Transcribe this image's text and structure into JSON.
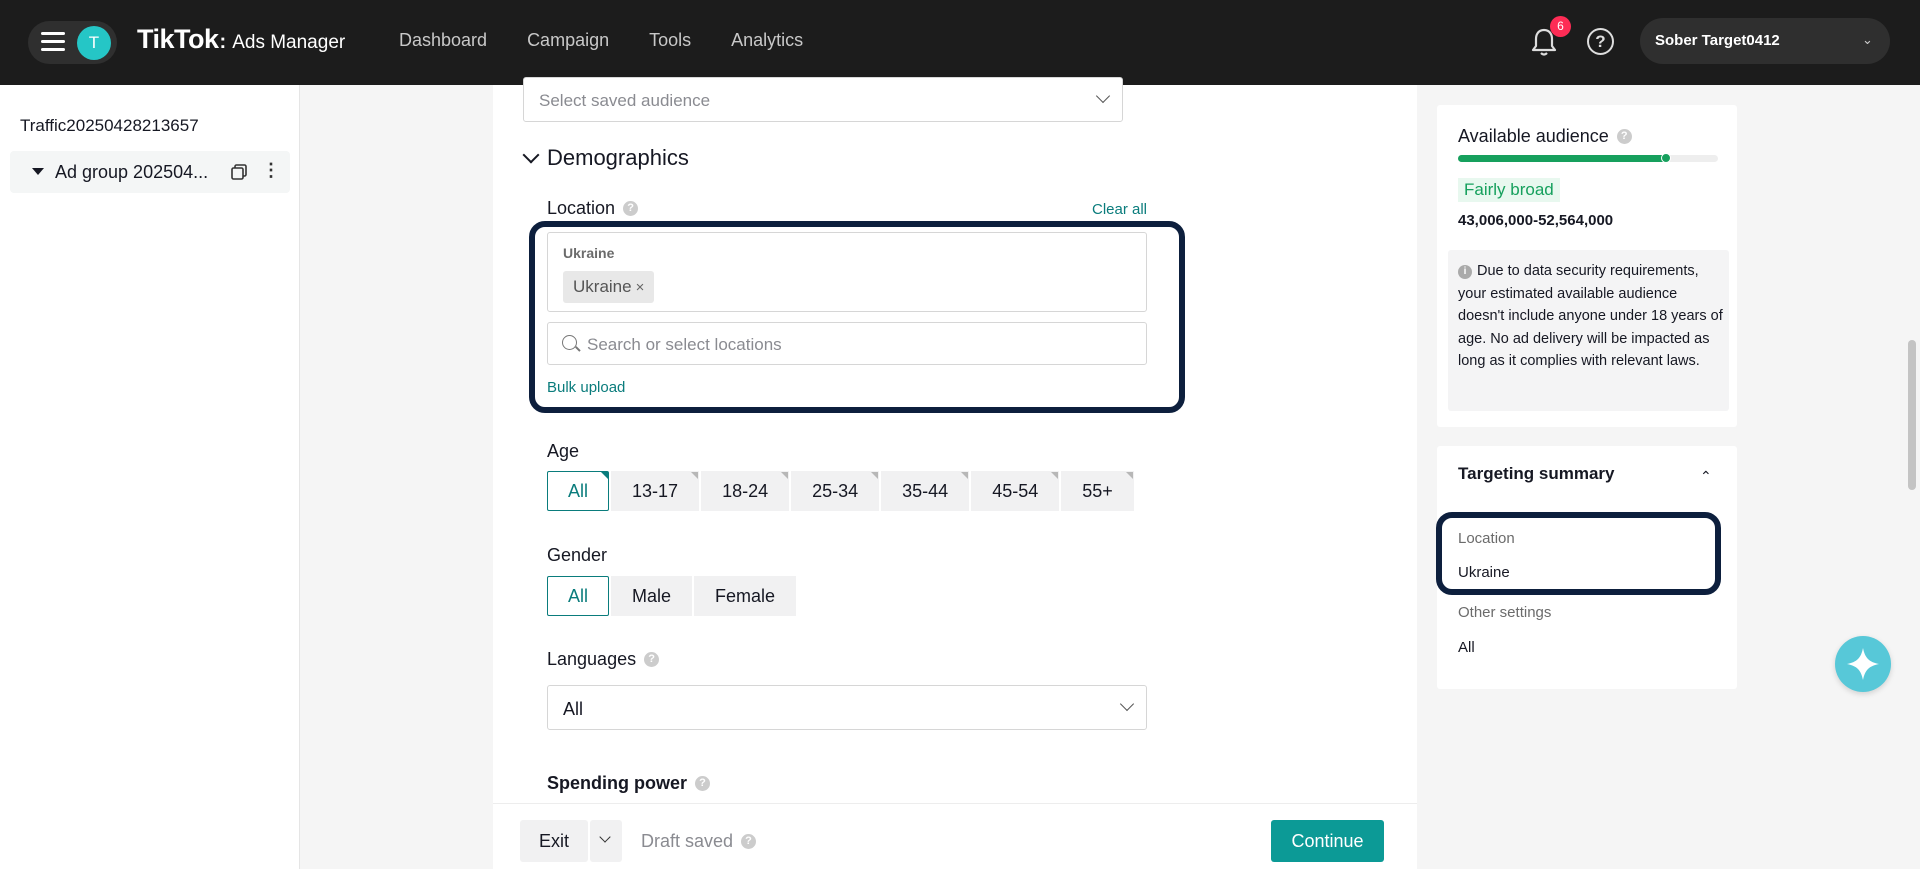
{
  "header": {
    "avatar_letter": "T",
    "brand": "TikTok",
    "brand_suffix": "Ads Manager",
    "nav": [
      "Dashboard",
      "Campaign",
      "Tools",
      "Analytics"
    ],
    "notification_count": "6",
    "help_symbol": "?",
    "account_name": "Sober Target0412"
  },
  "left_panel": {
    "campaign_name": "Traffic20250428213657",
    "ad_group_label": "Ad group 202504..."
  },
  "form": {
    "saved_audience_placeholder": "Select saved audience",
    "demographics_title": "Demographics",
    "location": {
      "label": "Location",
      "clear_all": "Clear all",
      "group_title": "Ukraine",
      "selected_tag": "Ukraine",
      "tag_remove": "×",
      "search_placeholder": "Search or select locations",
      "bulk_upload": "Bulk upload"
    },
    "age": {
      "label": "Age",
      "options": [
        "All",
        "13-17",
        "18-24",
        "25-34",
        "35-44",
        "45-54",
        "55+"
      ],
      "selected": "All"
    },
    "gender": {
      "label": "Gender",
      "options": [
        "All",
        "Male",
        "Female"
      ],
      "selected": "All"
    },
    "languages": {
      "label": "Languages",
      "value": "All"
    },
    "spending_power": {
      "label": "Spending power"
    }
  },
  "footer": {
    "exit_label": "Exit",
    "draft_status": "Draft saved",
    "continue_label": "Continue"
  },
  "right_panel": {
    "available_audience": {
      "title": "Available audience",
      "level": 0.8,
      "rating": "Fairly broad",
      "range": "43,006,000-52,564,000",
      "note": "Due to data security requirements, your estimated available audience doesn't include anyone under 18 years of age. No ad delivery will be impacted as long as it complies with relevant laws."
    },
    "targeting_summary": {
      "title": "Targeting summary",
      "location_label": "Location",
      "location_value": "Ukraine",
      "other_label": "Other settings",
      "other_value": "All"
    }
  },
  "colors": {
    "accent": "#0c9a96",
    "link": "#0a7c7c",
    "topbar": "#1c1c1c",
    "notification": "#fe2c55",
    "focus_outline": "#0d1f3d",
    "audience_green": "#16a05d"
  },
  "icons": [
    "hamburger-icon",
    "bell-icon",
    "help-icon",
    "chevron-down-icon",
    "copy-icon",
    "more-vertical-icon",
    "search-icon",
    "info-icon",
    "chevron-up-icon",
    "sparkle-icon"
  ]
}
